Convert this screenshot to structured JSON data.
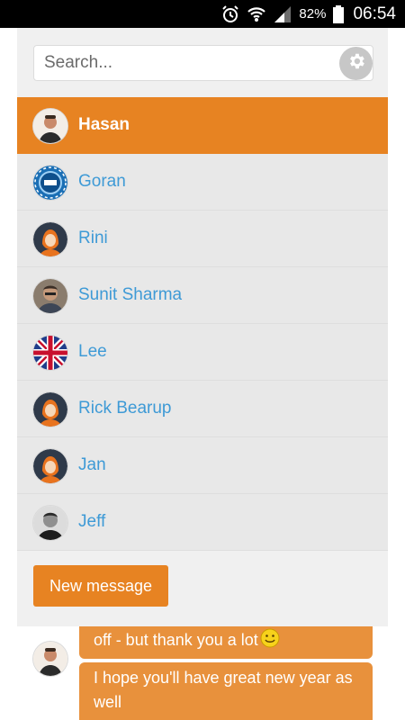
{
  "status_bar": {
    "battery_percent": "82%",
    "time": "06:54",
    "icons": [
      "alarm-icon",
      "wifi-icon",
      "signal-icon",
      "battery-icon"
    ]
  },
  "search": {
    "placeholder": "Search...",
    "value": ""
  },
  "contacts": [
    {
      "name": "Hasan",
      "active": true,
      "avatar": "hasan-avatar"
    },
    {
      "name": "Goran",
      "active": false,
      "avatar": "badge-avatar"
    },
    {
      "name": "Rini",
      "active": false,
      "avatar": "default-avatar"
    },
    {
      "name": "Sunit Sharma",
      "active": false,
      "avatar": "photo-avatar"
    },
    {
      "name": "Lee",
      "active": false,
      "avatar": "uk-flag-avatar"
    },
    {
      "name": "Rick Bearup",
      "active": false,
      "avatar": "default-avatar"
    },
    {
      "name": "Jan",
      "active": false,
      "avatar": "default-avatar"
    },
    {
      "name": "Jeff",
      "active": false,
      "avatar": "photo-avatar"
    }
  ],
  "new_message_label": "New message",
  "chat": {
    "messages": [
      {
        "text": "off - but thank you a lot",
        "emoji": "smiley-icon"
      },
      {
        "text": "I hope you'll have great new year as well"
      }
    ]
  },
  "colors": {
    "accent": "#e78322",
    "link": "#3e9ad6",
    "panel": "#f0f0f0",
    "row": "#e8e8e8"
  }
}
